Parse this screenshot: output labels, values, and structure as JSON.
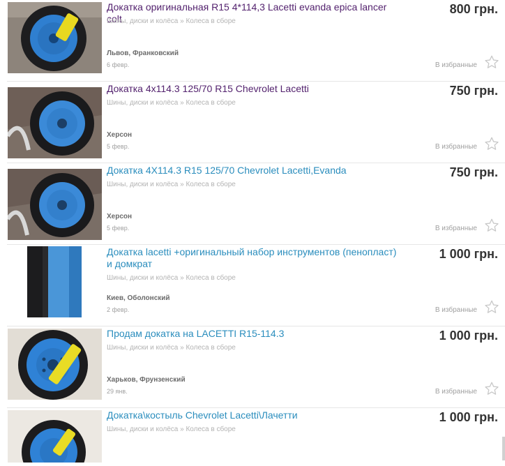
{
  "listings": [
    {
      "title": "Докатка оригинальная R15 4*114,3 Lacetti evanda epica lancer colt",
      "visited": true,
      "category": "Шины, диски и колёса » Колеса в сборе",
      "location": "Львов, Франковский",
      "date": "6 февр.",
      "price": "800 грн.",
      "favorite_label": "В избранные"
    },
    {
      "title": "Докатка 4х114.3 125/70 R15 Chevrolet Lacetti",
      "visited": true,
      "category": "Шины, диски и колёса » Колеса в сборе",
      "location": "Херсон",
      "date": "5 февр.",
      "price": "750 грн.",
      "favorite_label": "В избранные"
    },
    {
      "title": "Докатка 4Х114.3 R15 125/70 Chevrolet Lacetti,Evanda",
      "visited": false,
      "category": "Шины, диски и колёса » Колеса в сборе",
      "location": "Херсон",
      "date": "5 февр.",
      "price": "750 грн.",
      "favorite_label": "В избранные"
    },
    {
      "title": "Докатка lacetti +оригинальный набор инструментов (пенопласт) и домкрат",
      "visited": false,
      "category": "Шины, диски и колёса » Колеса в сборе",
      "location": "Киев, Оболонский",
      "date": "2 февр.",
      "price": "1 000 грн.",
      "favorite_label": "В избранные"
    },
    {
      "title": "Продам докатка на LACETTI R15-114.3",
      "visited": false,
      "category": "Шины, диски и колёса » Колеса в сборе",
      "location": "Харьков, Фрунзенский",
      "date": "29 янв.",
      "price": "1 000 грн.",
      "favorite_label": "В избранные"
    },
    {
      "title": "Докатка\\костыль Chevrolet Lacetti\\Лачетти",
      "visited": false,
      "category": "Шины, диски и колёса » Колеса в сборе",
      "location": "",
      "date": "",
      "price": "1 000 грн.",
      "favorite_label": ""
    }
  ],
  "icons": {
    "favorite": "star-outline-icon"
  },
  "colors": {
    "visited_link": "#53226e",
    "link": "#2a8dbd",
    "wheel_blue": "#2f7fd0",
    "price": "#333333"
  }
}
